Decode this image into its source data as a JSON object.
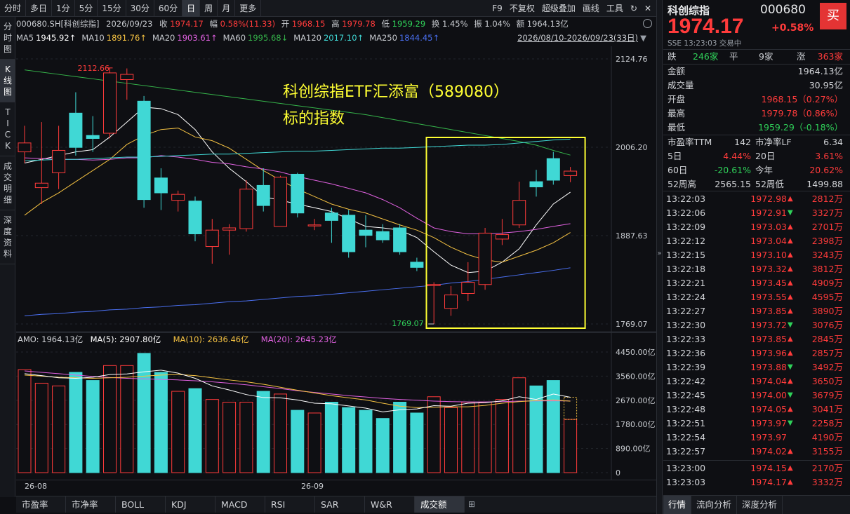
{
  "toolbar": {
    "periods": [
      "分时",
      "多日",
      "1分",
      "5分",
      "15分",
      "30分",
      "60分",
      "日",
      "周",
      "月",
      "更多"
    ],
    "active_period": "日",
    "right_items": [
      "F9",
      "不复权",
      "超级叠加",
      "画线",
      "工具"
    ]
  },
  "left_nav": [
    "分时图",
    "K线图",
    "TICK",
    "成交明细",
    "深度资料"
  ],
  "left_nav_active": "K线图",
  "infobar": {
    "code": "000680.SH[科创综指]",
    "date": "2026/09/23",
    "close_label": "收",
    "close": "1974.17",
    "chg_label": "幅",
    "chg": "0.58%(11.33)",
    "open_label": "开",
    "open": "1968.15",
    "high_label": "高",
    "high": "1979.78",
    "low_label": "低",
    "low": "1959.29",
    "turnover_label": "换",
    "turnover": "1.45%",
    "amp_label": "振",
    "amp": "1.04%",
    "amount_label": "额",
    "amount": "1964.13亿"
  },
  "ma_bar": {
    "items": [
      {
        "label": "MA5",
        "value": "1945.92↑",
        "color": "#ffffff"
      },
      {
        "label": "MA10",
        "value": "1891.76↑",
        "color": "#f5c242"
      },
      {
        "label": "MA20",
        "value": "1903.61↑",
        "color": "#e061e0"
      },
      {
        "label": "MA60",
        "value": "1995.68↓",
        "color": "#35b34a"
      },
      {
        "label": "MA120",
        "value": "2017.10↑",
        "color": "#40d8d5"
      },
      {
        "label": "MA250",
        "value": "1844.45↑",
        "color": "#4a6ff0"
      }
    ],
    "range_text": "2026/08/10-2026/09/23(33日)"
  },
  "annotation": {
    "line1": "科创综指ETF汇添富（589080）",
    "line2": "标的指数"
  },
  "main_axis": [
    "2124.76",
    "2006.20",
    "1887.63",
    "1769.07"
  ],
  "max_label": "2112.66",
  "min_label": "1769.07",
  "vol_bar": {
    "amo": "AMO: 1964.13亿",
    "ma5": "MA(5): 2907.80亿",
    "ma10": "MA(10): 2636.46亿",
    "ma20": "MA(20): 2645.23亿"
  },
  "vol_axis": [
    "4450.00亿",
    "3560.00亿",
    "2670.00亿",
    "1780.00亿",
    "890.00亿",
    "0"
  ],
  "date_labels": [
    "26-08",
    "26-09"
  ],
  "bottom_tabs": [
    "市盈率",
    "市净率",
    "BOLL",
    "KDJ",
    "MACD",
    "RSI",
    "SAR",
    "W&R",
    "成交额"
  ],
  "bottom_active": "成交额",
  "chart_data": {
    "type": "candlestick",
    "title": "000680.SH 科创综指 日K",
    "ylim": [
      1769.07,
      2124.76
    ],
    "candles": [
      {
        "o": 2000,
        "h": 2035,
        "l": 1985,
        "c": 2012
      },
      {
        "o": 1952,
        "h": 2040,
        "l": 1930,
        "c": 1958
      },
      {
        "o": 1972,
        "h": 2035,
        "l": 1950,
        "c": 2002
      },
      {
        "o": 2052,
        "h": 2080,
        "l": 1995,
        "c": 2006
      },
      {
        "o": 2022,
        "h": 2048,
        "l": 2000,
        "c": 2018
      },
      {
        "o": 2025,
        "h": 2112.66,
        "l": 2018,
        "c": 2106
      },
      {
        "o": 2097,
        "h": 2112,
        "l": 2070,
        "c": 2104
      },
      {
        "o": 2068,
        "h": 2075,
        "l": 1925,
        "c": 1936
      },
      {
        "o": 1965,
        "h": 1978,
        "l": 1922,
        "c": 1945
      },
      {
        "o": 1935,
        "h": 1948,
        "l": 1920,
        "c": 1943
      },
      {
        "o": 1934,
        "h": 1940,
        "l": 1880,
        "c": 1890
      },
      {
        "o": 1873,
        "h": 1910,
        "l": 1850,
        "c": 1895
      },
      {
        "o": 1895,
        "h": 1903,
        "l": 1862,
        "c": 1898
      },
      {
        "o": 1897,
        "h": 1962,
        "l": 1893,
        "c": 1950
      },
      {
        "o": 1955,
        "h": 1978,
        "l": 1920,
        "c": 1928
      },
      {
        "o": 1900,
        "h": 1968,
        "l": 1900,
        "c": 1966
      },
      {
        "o": 1970,
        "h": 1972,
        "l": 1912,
        "c": 1918
      },
      {
        "o": 1902,
        "h": 1910,
        "l": 1895,
        "c": 1902
      },
      {
        "o": 1918,
        "h": 1925,
        "l": 1878,
        "c": 1908
      },
      {
        "o": 1915,
        "h": 1922,
        "l": 1858,
        "c": 1866
      },
      {
        "o": 1895,
        "h": 1915,
        "l": 1872,
        "c": 1888
      },
      {
        "o": 1893,
        "h": 1903,
        "l": 1878,
        "c": 1882
      },
      {
        "o": 1898,
        "h": 1903,
        "l": 1862,
        "c": 1866
      },
      {
        "o": 1852,
        "h": 1858,
        "l": 1840,
        "c": 1845
      },
      {
        "o": 1821,
        "h": 1825,
        "l": 1769.07,
        "c": 1822
      },
      {
        "o": 1790,
        "h": 1820,
        "l": 1780,
        "c": 1808
      },
      {
        "o": 1810,
        "h": 1852,
        "l": 1800,
        "c": 1825
      },
      {
        "o": 1822,
        "h": 1898,
        "l": 1815,
        "c": 1891
      },
      {
        "o": 1883,
        "h": 1910,
        "l": 1875,
        "c": 1889
      },
      {
        "o": 1902,
        "h": 1960,
        "l": 1898,
        "c": 1935
      },
      {
        "o": 1960,
        "h": 1976,
        "l": 1940,
        "c": 1953
      },
      {
        "o": 1991,
        "h": 2000,
        "l": 1956,
        "c": 1962
      },
      {
        "o": 1968.15,
        "h": 1979.78,
        "l": 1959.29,
        "c": 1974.17
      }
    ],
    "ma_lines": {
      "MA5": [
        1985,
        1990,
        1995,
        2000,
        2003,
        2020,
        2040,
        2060,
        2058,
        2050,
        2030,
        2000,
        1978,
        1960,
        1940,
        1935,
        1930,
        1925,
        1920,
        1910,
        1900,
        1898,
        1895,
        1885,
        1866,
        1848,
        1838,
        1840,
        1852,
        1870,
        1902,
        1930,
        1945.92
      ],
      "MA10": [
        1915,
        1932,
        1945,
        1960,
        1975,
        1990,
        2010,
        2022,
        2030,
        2032,
        2020,
        2015,
        2005,
        1990,
        1975,
        1962,
        1950,
        1940,
        1930,
        1923,
        1918,
        1910,
        1902,
        1895,
        1885,
        1872,
        1862,
        1855,
        1852,
        1860,
        1868,
        1878,
        1891.76
      ],
      "MA20": [
        1992,
        1991,
        1990,
        1990,
        1989,
        1990,
        1992,
        1992,
        1995,
        1993,
        1990,
        1986,
        1984,
        1980,
        1977,
        1973,
        1967,
        1962,
        1957,
        1951,
        1945,
        1936,
        1925,
        1911,
        1898,
        1893,
        1890,
        1890,
        1891,
        1893,
        1896,
        1900,
        1903.61
      ],
      "MA60": [
        2110,
        2107,
        2104,
        2101,
        2098,
        2095,
        2092,
        2089,
        2086,
        2083,
        2080,
        2077,
        2074,
        2071,
        2068,
        2065,
        2062,
        2059,
        2056,
        2053,
        2050,
        2046,
        2042,
        2038,
        2034,
        2030,
        2026,
        2022,
        2018,
        2014,
        2009,
        2002,
        1995.68
      ],
      "MA120": [
        1988,
        1989,
        1990,
        1990,
        1991,
        1992,
        1993,
        1993,
        1994,
        1995,
        1996,
        1997,
        1997,
        1998,
        1999,
        2000,
        2001,
        2001,
        2002,
        2003,
        2004,
        2005,
        2005,
        2006,
        2007,
        2008,
        2009,
        2009,
        2010,
        2012,
        2014,
        2016,
        2017.1
      ],
      "MA250": [
        1780,
        1782,
        1783,
        1785,
        1786,
        1788,
        1789,
        1791,
        1792,
        1794,
        1795,
        1797,
        1799,
        1800,
        1802,
        1804,
        1806,
        1807,
        1809,
        1811,
        1813,
        1815,
        1817,
        1819,
        1821,
        1824,
        1826,
        1829,
        1832,
        1835,
        1838,
        1841,
        1844.45
      ]
    },
    "volume": {
      "ylim": [
        0,
        4450
      ],
      "values": [
        3800,
        3300,
        3200,
        3700,
        3400,
        3950,
        3950,
        4400,
        3700,
        3000,
        3100,
        2700,
        2600,
        2600,
        3000,
        2900,
        2300,
        2200,
        2600,
        2400,
        2300,
        2000,
        2600,
        2200,
        2800,
        2400,
        2600,
        2600,
        2700,
        3500,
        3200,
        3400,
        1964.13
      ],
      "MA5": [
        3650,
        3580,
        3500,
        3480,
        3520,
        3620,
        3640,
        3720,
        3780,
        3670,
        3480,
        3200,
        3050,
        2880,
        2770,
        2760,
        2680,
        2560,
        2540,
        2460,
        2380,
        2240,
        2320,
        2350,
        2470,
        2450,
        2560,
        2580,
        2650,
        2800,
        2700,
        2900,
        2780
      ],
      "MA10": [
        3600,
        3560,
        3520,
        3500,
        3480,
        3500,
        3520,
        3560,
        3600,
        3620,
        3580,
        3500,
        3420,
        3350,
        3260,
        3150,
        3040,
        2940,
        2840,
        2760,
        2680,
        2560,
        2450,
        2400,
        2410,
        2430,
        2430,
        2480,
        2560,
        2620,
        2660,
        2680,
        2636.46
      ],
      "MA20": [
        3750,
        3700,
        3650,
        3600,
        3550,
        3510,
        3480,
        3460,
        3440,
        3420,
        3390,
        3350,
        3300,
        3240,
        3170,
        3100,
        3020,
        2960,
        2900,
        2840,
        2790,
        2740,
        2700,
        2670,
        2640,
        2620,
        2610,
        2610,
        2620,
        2640,
        2645,
        2648,
        2645.23
      ]
    }
  },
  "panel": {
    "name": "科创综指",
    "code": "000680",
    "buy_label": "买",
    "price": "1974.17",
    "change_pct": "+0.58%",
    "sub": "SSE  13:23:03 交易中",
    "breadth": {
      "down_label": "跌",
      "down": "246家",
      "flat_label": "平",
      "flat": "9家",
      "up_label": "涨",
      "up": "363家"
    },
    "stats": [
      {
        "label": "金额",
        "value": "1964.13亿",
        "color": "#d2d4d8"
      },
      {
        "label": "成交量",
        "value": "30.95亿",
        "color": "#d2d4d8"
      },
      {
        "label": "开盘",
        "value": "1968.15（0.27%）",
        "color": "#ff3b3b"
      },
      {
        "label": "最高",
        "value": "1979.78（0.86%）",
        "color": "#ff3b3b"
      },
      {
        "label": "最低",
        "value": "1959.29（-0.18%）",
        "color": "#2fd159"
      }
    ],
    "valuation": [
      {
        "l1": "市盈率TTM",
        "v1": "142",
        "c1": "#d2d4d8",
        "l2": "市净率LF",
        "v2": "6.34",
        "c2": "#d2d4d8"
      },
      {
        "l1": "5日",
        "v1": "4.44%",
        "c1": "#ff3b3b",
        "l2": "20日",
        "v2": "3.61%",
        "c2": "#ff3b3b"
      },
      {
        "l1": "60日",
        "v1": "-20.61%",
        "c1": "#2fd159",
        "l2": "今年",
        "v2": "20.62%",
        "c2": "#ff3b3b"
      },
      {
        "l1": "52周高",
        "v1": "2565.15",
        "c1": "#d2d4d8",
        "l2": "52周低",
        "v2": "1499.88",
        "c2": "#d2d4d8"
      }
    ],
    "ticks": [
      {
        "t": "13:22:03",
        "p": "1972.98",
        "d": "up",
        "v": "2812万"
      },
      {
        "t": "13:22:06",
        "p": "1972.91",
        "d": "down",
        "v": "3327万"
      },
      {
        "t": "13:22:09",
        "p": "1973.03",
        "d": "up",
        "v": "2701万"
      },
      {
        "t": "13:22:12",
        "p": "1973.04",
        "d": "up",
        "v": "2398万"
      },
      {
        "t": "13:22:15",
        "p": "1973.10",
        "d": "up",
        "v": "3243万"
      },
      {
        "t": "13:22:18",
        "p": "1973.32",
        "d": "up",
        "v": "3812万"
      },
      {
        "t": "13:22:21",
        "p": "1973.45",
        "d": "up",
        "v": "4909万"
      },
      {
        "t": "13:22:24",
        "p": "1973.55",
        "d": "up",
        "v": "4595万"
      },
      {
        "t": "13:22:27",
        "p": "1973.85",
        "d": "up",
        "v": "3890万"
      },
      {
        "t": "13:22:30",
        "p": "1973.72",
        "d": "down",
        "v": "3076万"
      },
      {
        "t": "13:22:33",
        "p": "1973.85",
        "d": "up",
        "v": "2845万"
      },
      {
        "t": "13:22:36",
        "p": "1973.96",
        "d": "up",
        "v": "2857万"
      },
      {
        "t": "13:22:39",
        "p": "1973.88",
        "d": "down",
        "v": "3492万"
      },
      {
        "t": "13:22:42",
        "p": "1974.04",
        "d": "up",
        "v": "3650万"
      },
      {
        "t": "13:22:45",
        "p": "1974.00",
        "d": "down",
        "v": "3679万"
      },
      {
        "t": "13:22:48",
        "p": "1974.05",
        "d": "up",
        "v": "3041万"
      },
      {
        "t": "13:22:51",
        "p": "1973.97",
        "d": "down",
        "v": "2258万"
      },
      {
        "t": "13:22:54",
        "p": "1973.97",
        "d": "flat",
        "v": "4190万"
      },
      {
        "t": "13:22:57",
        "p": "1974.02",
        "d": "up",
        "v": "3155万"
      },
      {
        "t": "13:23:00",
        "p": "1974.15",
        "d": "up",
        "v": "2170万"
      },
      {
        "t": "13:23:03",
        "p": "1974.17",
        "d": "up",
        "v": "3332万"
      }
    ],
    "tabs": [
      "行情",
      "流向分析",
      "深度分析"
    ],
    "active_tab": "行情"
  },
  "colors": {
    "up": "#ff3b3b",
    "down": "#40d8d5",
    "highlight": "#ffff33",
    "annotation": "#ffff33"
  }
}
